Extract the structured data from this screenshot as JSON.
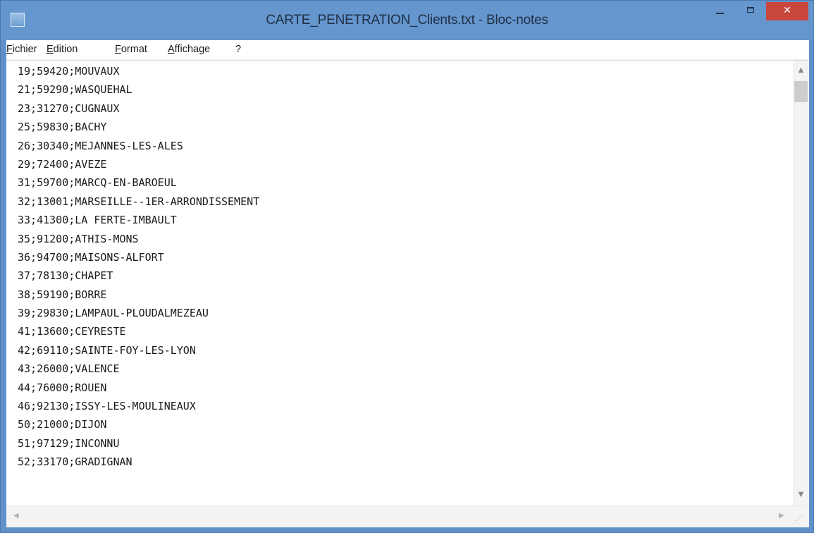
{
  "window": {
    "title": "CARTE_PENETRATION_Clients.txt - Bloc-notes",
    "minimize_glyph": "",
    "close_glyph": "✕"
  },
  "menu": [
    {
      "label": "Fichier"
    },
    {
      "label": "Edition"
    },
    {
      "label": "Format"
    },
    {
      "label": "Affichage"
    },
    {
      "label": "?"
    }
  ],
  "document": {
    "lines": [
      "19;59420;MOUVAUX",
      "21;59290;WASQUEHAL",
      "23;31270;CUGNAUX",
      "25;59830;BACHY",
      "26;30340;MEJANNES-LES-ALES",
      "29;72400;AVEZE",
      "31;59700;MARCQ-EN-BAROEUL",
      "32;13001;MARSEILLE--1ER-ARRONDISSEMENT",
      "33;41300;LA FERTE-IMBAULT",
      "35;91200;ATHIS-MONS",
      "36;94700;MAISONS-ALFORT",
      "37;78130;CHAPET",
      "38;59190;BORRE",
      "39;29830;LAMPAUL-PLOUDALMEZEAU",
      "41;13600;CEYRESTE",
      "42;69110;SAINTE-FOY-LES-LYON",
      "43;26000;VALENCE",
      "44;76000;ROUEN",
      "46;92130;ISSY-LES-MOULINEAUX",
      "50;21000;DIJON",
      "51;97129;INCONNU",
      "52;33170;GRADIGNAN"
    ]
  },
  "icons": {
    "app": "notepad-icon",
    "minimize": "minimize-icon",
    "maximize": "maximize-icon",
    "close": "close-icon"
  },
  "colors": {
    "titlebar": "#6596cd",
    "close_button": "#c9463d",
    "editor_bg": "#ffffff"
  }
}
